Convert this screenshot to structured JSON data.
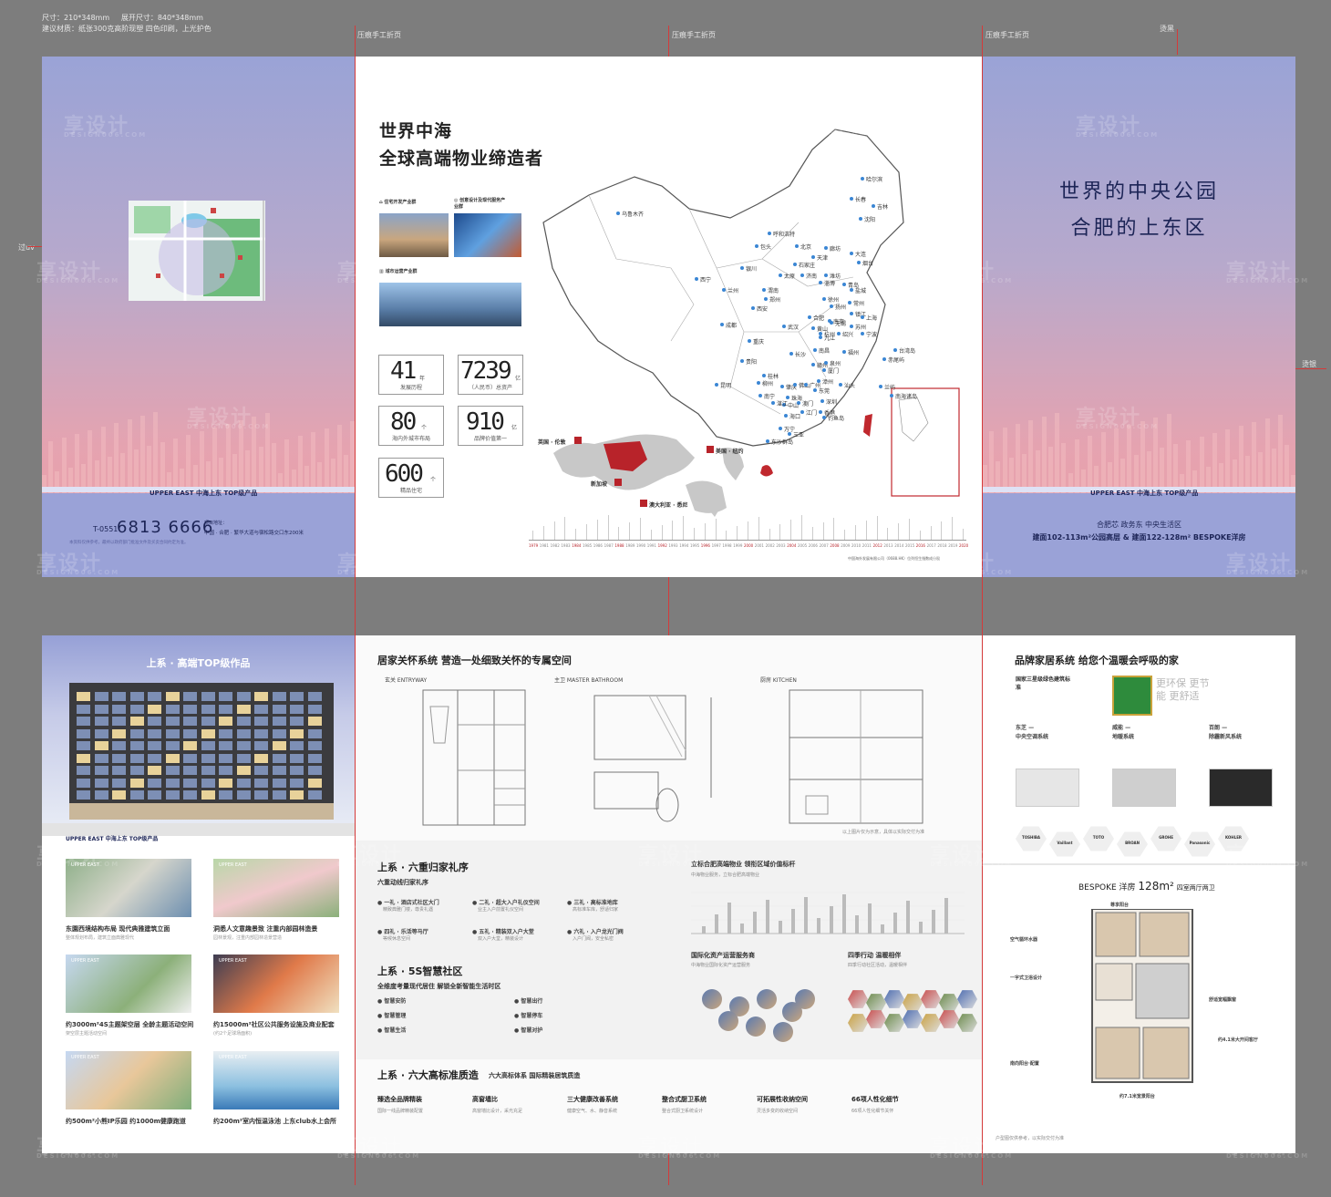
{
  "spec": {
    "size": "尺寸：210*348mm",
    "unfold": "展开尺寸：840*348mm",
    "material": "建议材质：纸张300克高阶现塑 四色印刷，上光护色"
  },
  "fold_labels": [
    "压痕手工折页",
    "压痕手工折页",
    "压痕手工折页"
  ],
  "side_labels": {
    "top_right": "烫黑",
    "left": "过uv",
    "right": "烫银"
  },
  "back_cover": {
    "tagline": "UPPER EAST 中海上东 TOP级产品",
    "phone_prefix": "T-0551",
    "phone": "6813 6666",
    "address_label": "项目地址：",
    "address": "中国 · 合肥 · 繁华大道与宿松路交口东200米",
    "disclaimer": "本资料仅供参考，最终以政府部门批准文件及买卖合同约定为准。"
  },
  "about": {
    "title1": "世界中海",
    "title2": "全球高端物业缔造者",
    "biz1": "住宅开发产业群",
    "biz2": "创意设计及现代服务产业群",
    "biz3": "城市运营产业群",
    "stats": [
      {
        "num": "41",
        "unit": "年",
        "label": "发展历程"
      },
      {
        "num": "7239",
        "unit": "亿",
        "label": "（人民币）总资产"
      },
      {
        "num": "80",
        "unit": "个",
        "label": "海内外城市布局"
      },
      {
        "num": "910",
        "unit": "亿",
        "label": "品牌价值第一"
      },
      {
        "num": "600",
        "unit": "个",
        "label": "精品住宅"
      }
    ],
    "world": [
      "英国 · 伦敦",
      "美国 · 纽约",
      "新加坡",
      "澳大利亚 · 悉尼"
    ],
    "cities": [
      "哈尔滨",
      "长春",
      "吉林",
      "沈阳",
      "乌鲁木齐",
      "呼和浩特",
      "包头",
      "北京",
      "廊坊",
      "天津",
      "石家庄",
      "银川",
      "太原",
      "济南",
      "淄博",
      "烟台",
      "青岛",
      "潍坊",
      "大连",
      "西宁",
      "兰州",
      "渭南",
      "郑州",
      "徐州",
      "扬州",
      "常州",
      "镇江",
      "南京",
      "盐城",
      "合肥",
      "无锡",
      "苏州",
      "上海",
      "杭州",
      "绍兴",
      "宁波",
      "西安",
      "成都",
      "武汉",
      "黄山",
      "九江",
      "重庆",
      "长沙",
      "南昌",
      "赣州",
      "泉州",
      "福州",
      "厦门",
      "漳州",
      "汕头",
      "桂林",
      "贵阳",
      "昆明",
      "柳州",
      "南宁",
      "肇庆",
      "佛山",
      "广州",
      "东莞",
      "深圳",
      "香港",
      "珠海",
      "澳门",
      "江门",
      "中山",
      "湛江",
      "海口",
      "万宁",
      "三亚",
      "东沙群岛",
      "钓鱼岛",
      "赤尾屿",
      "台湾岛",
      "兰屿",
      "南海诸岛"
    ],
    "timeline": [
      "1979",
      "1981",
      "1982",
      "1983",
      "1984",
      "1985",
      "1986",
      "1987",
      "1988",
      "1989",
      "1990",
      "1991",
      "1992",
      "1993",
      "1994",
      "1995",
      "1996",
      "1997",
      "1998",
      "1999",
      "2000",
      "2001",
      "2002",
      "2003",
      "2004",
      "2005",
      "2006",
      "2007",
      "2008",
      "2009",
      "2010",
      "2011",
      "2012",
      "2013",
      "2014",
      "2015",
      "2016",
      "2017",
      "2018",
      "2019",
      "2020"
    ],
    "timeline_note": "中国海外发展有限公司（0688.HK）位列恒生指数成分股"
  },
  "cover": {
    "title1": "世界的中央公园",
    "title2": "合肥的上东区",
    "tagline": "UPPER EAST 中海上东 TOP级产品",
    "loc": "合肥芯 政务东 中央生活区",
    "product": "建面102-113m²公园高层 & 建面122-128m² BESPOKE洋房"
  },
  "works": {
    "title": "上系 · 高端TOP级作品",
    "tagline": "UPPER EAST 中海上东 TOP级产品",
    "items": [
      {
        "cap": "东園西境结构布局 现代典雅建筑立面",
        "sub": "整体规划布局，建筑立面典雅现代"
      },
      {
        "cap": "洞悉人文意趣景致 注重内部园林造景",
        "sub": "园林景观，注重内部园林造景营造"
      },
      {
        "cap": "约3000m²4S主题架空层 全龄主题活动空间",
        "sub": "架空层主题活动空间"
      },
      {
        "cap": "约15000m²社区公共服务设施及商业配套",
        "sub": "(约2个足球场面积)"
      },
      {
        "cap": "约500m²小熊IP乐园 约1000m健康跑道",
        "sub": ""
      },
      {
        "cap": "约200m²室内恒温泳池 上东club水上会所",
        "sub": ""
      }
    ],
    "photo_tag": "UPPER EAST"
  },
  "care": {
    "title": "居家关怀系统 营造一处细致关怀的专属空间",
    "entry": "玄关  ENTRYWAY",
    "bath": "主卫  MASTER BATHROOM",
    "kitchen": "厨房  KITCHEN",
    "footnote": "以上图片仅为示意，具体以实际交付为准"
  },
  "ritual": {
    "title": "上系 · 六重归家礼序",
    "sub": "六重动线归家礼序",
    "items": [
      {
        "t": "一礼 · 酒店式社区大门",
        "d": "精致典雅门楼，尊贵礼遇"
      },
      {
        "t": "二礼 · 超大入户礼仪空间",
        "d": "业主入户前置礼仪空间"
      },
      {
        "t": "三礼 · 高标准地库",
        "d": "高标准车库，舒适归家"
      },
      {
        "t": "四礼 · 乐活等马厅",
        "d": "等候休息空间"
      },
      {
        "t": "五礼 · 精装双入户大堂",
        "d": "双入户大堂，精装设计"
      },
      {
        "t": "六礼 · 入户龙光门阀",
        "d": "入户门阀，安全私密"
      }
    ]
  },
  "smart": {
    "title": "上系 · 5S智慧社区",
    "sub": "全维度考量现代居住 解锁全新智能生活时区",
    "items": [
      "智慧安防",
      "智慧出行",
      "智慧管理",
      "智慧停车",
      "智慧生活",
      "智慧对护"
    ]
  },
  "quality": {
    "title": "上系 · 六大高标准质造",
    "sub": "六大高标体系 国际精装居筑质造",
    "items": [
      {
        "t": "臻选全品牌精装",
        "d": "国际一线品牌精装配置"
      },
      {
        "t": "高窗墙比",
        "d": "高窗墙比设计，采光充足"
      },
      {
        "t": "三大健康改善系统",
        "d": "健康空气、水、静音系统"
      },
      {
        "t": "整合式厨卫系统",
        "d": "整合式厨卫系统设计"
      },
      {
        "t": "可拓展性收纳空间",
        "d": "灵活多变的收纳空间"
      },
      {
        "t": "66项人性化细节",
        "d": "66项人性化细节关怀"
      }
    ]
  },
  "value": {
    "title": "立标合肥高端物业 领衔区域价值标杆",
    "desc": "中海物业服务，立标合肥高端物业",
    "service_title": "国际化资产运营服务商",
    "service_desc": "中海物业国际化资产运营服务",
    "season_title": "四季行动 温暖相伴",
    "season_desc": "四季行动社区活动，温暖相伴"
  },
  "brand": {
    "title": "品牌家居系统 给您个温暖会呼吸的家",
    "green_title": "国家三星级绿色建筑标准",
    "green_desc": "更环保 更节能 更舒适",
    "sys": [
      {
        "brand": "东芝",
        "t": "中央空调系统"
      },
      {
        "brand": "威能",
        "t": "地暖系统"
      },
      {
        "brand": "百朗",
        "t": "除霾新风系统"
      }
    ],
    "logos": [
      "TOSHIBA",
      "Vaillant",
      "TOTO",
      "BROAN",
      "GROHE",
      "Panasonic",
      "KOHLER"
    ]
  },
  "bespoke": {
    "title": "BESPOKE 洋房",
    "area": "128m²",
    "layout": "四室两厅两卫",
    "labels": [
      "尊享阳台",
      "空气循环水器",
      "一字式卫浴设计",
      "舒适宽幅飘窗",
      "南向阳台·配置",
      "约4.1米大开间客厅",
      "约7.1米宽景阳台"
    ],
    "footnote": "户型图仅供参考，以实际交付为准"
  },
  "watermark": "享设计",
  "watermark_sub": "DESIGN006.COM",
  "colors": {
    "brand_red": "#b8232a",
    "cover_blue": "#9aa2d7",
    "cover_pink": "#ee9ea5",
    "map_dot": "#3a86d4"
  }
}
